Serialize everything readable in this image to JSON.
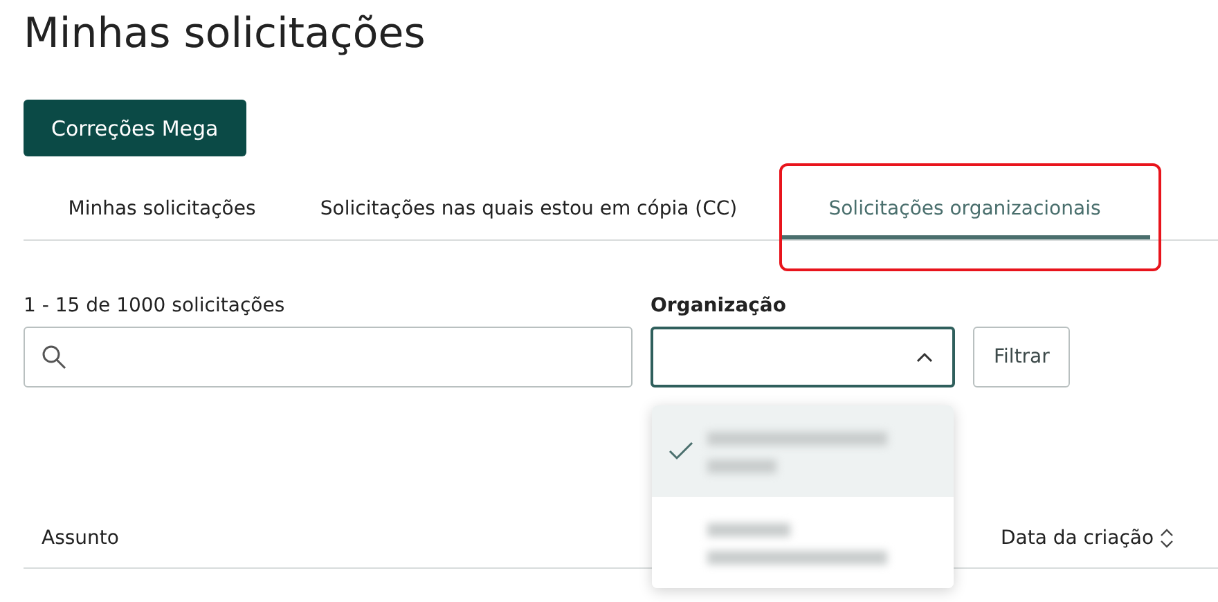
{
  "title": "Minhas solicitações",
  "primary_button": "Correções Mega",
  "tabs": [
    {
      "label": "Minhas solicitações",
      "selected": false,
      "highlighted": false
    },
    {
      "label": "Solicitações nas quais estou em cópia (CC)",
      "selected": false,
      "highlighted": false
    },
    {
      "label": "Solicitações organizacionais",
      "selected": true,
      "highlighted": true
    }
  ],
  "result_count": "1 - 15 de 1000 solicitações",
  "organization": {
    "label": "Organização",
    "expanded": true,
    "options": [
      {
        "selected": true
      },
      {
        "selected": false
      }
    ]
  },
  "filter_button": "Filtrar",
  "table": {
    "columns": [
      {
        "label": "Assunto",
        "sortable": false
      },
      {
        "label": "Data da criação",
        "sortable": true
      }
    ]
  }
}
